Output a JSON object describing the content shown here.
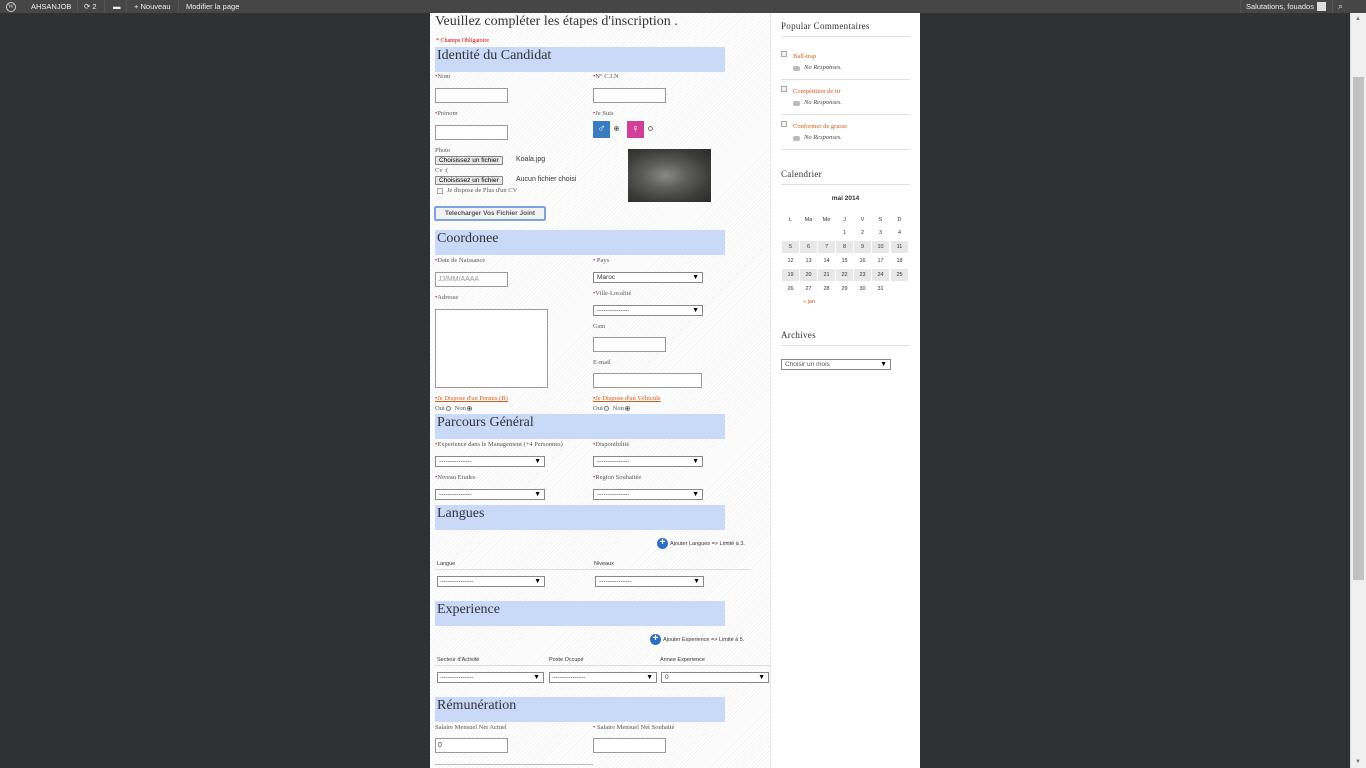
{
  "adminbar": {
    "site_name": "AHSANJOB",
    "updates_count": "2",
    "new_label": "Nouveau",
    "edit_label": "Modifier la page",
    "greeting": "Salutations, fouados"
  },
  "form": {
    "title": "Veuillez compléter les étapes d'inscription .",
    "required_note": "* Champs Obligatoire",
    "identite": {
      "title": "Identité du Candidat",
      "nom": "Nom",
      "cin": "N° C.I.N",
      "prenom": "Prénom",
      "je_suis": "Je Suis",
      "photo": "Photo",
      "choose_file": "Choisissez un fichier",
      "photo_file": "Koala.jpg",
      "cv": "Cv :(",
      "cv_file": "Aucun fichier choisi",
      "plus_cv": "Je dispose de Plus d'un CV",
      "upload_button": "Telecharger Vos Fichier Joint"
    },
    "coordonee": {
      "title": "Coordonee",
      "date_naissance": "Date de Naissance",
      "date_placeholder": "JJ/MM/AAAA",
      "pays": "Pays",
      "pays_value": "Maroc",
      "adresse": "Adresse",
      "ville": "Ville-Localité",
      "ville_value": "---------------",
      "gsm": "Gsm",
      "email": "E-mail",
      "permis": "Je Dispose d'un Permis (B)",
      "vehicule": "Je Dispose d'un Véhicule",
      "oui": "Oui",
      "non": "Non"
    },
    "parcours": {
      "title": "Parcours Général",
      "experience_mgmt": "Experience dans le Management (+4 Personnes)",
      "disponibilite": "Disponibilité",
      "niveau_etudes": "Niveau Etudes",
      "region": "Region Souhaitée",
      "empty": "---------------"
    },
    "langues": {
      "title": "Langues",
      "add_label": "Ajouter Langues => Limité à 3.",
      "col_langue": "Langue",
      "col_niveau": "Niveaux",
      "empty": "---------------"
    },
    "experience": {
      "title": "Experience",
      "add_label": "Ajouter Experience => Limité à 5.",
      "col_secteur": "Secteur d'Activité",
      "col_poste": "Poste Occupé",
      "col_annee": "Annee Experience",
      "empty": "---------------",
      "annee_value": "0"
    },
    "remuneration": {
      "title": "Rémunération",
      "actuel": "Salaire Mensuel Net Actuel",
      "souhaite": "Salaire Mensuel Net Souhaité",
      "actuel_value": "0"
    }
  },
  "sidebar": {
    "popular_title": "Popular Commentaires",
    "comments": [
      {
        "title": "Ball-trap",
        "responses": "No Responses."
      },
      {
        "title": "Compétition de tir",
        "responses": "No Responses."
      },
      {
        "title": "Conformer de grasse",
        "responses": "No Responses."
      }
    ],
    "calendar_title": "Calendrier",
    "calendar_month": "mai 2014",
    "calendar_days": [
      "L",
      "Ma",
      "Me",
      "J",
      "V",
      "S",
      "D"
    ],
    "calendar_weeks": [
      [
        "",
        "",
        "",
        "1",
        "2",
        "3",
        "4"
      ],
      [
        "5",
        "6",
        "7",
        "8",
        "9",
        "10",
        "11"
      ],
      [
        "12",
        "13",
        "14",
        "15",
        "16",
        "17",
        "18"
      ],
      [
        "19",
        "20",
        "21",
        "22",
        "23",
        "24",
        "25"
      ],
      [
        "26",
        "27",
        "28",
        "29",
        "30",
        "31",
        ""
      ]
    ],
    "calendar_prev": "« jan",
    "archives_title": "Archives",
    "archives_select": "Choisir un mois"
  },
  "colors": {
    "section_bg": "#c9d9f8",
    "link": "#d55a1a",
    "adminbar": "#464646"
  }
}
